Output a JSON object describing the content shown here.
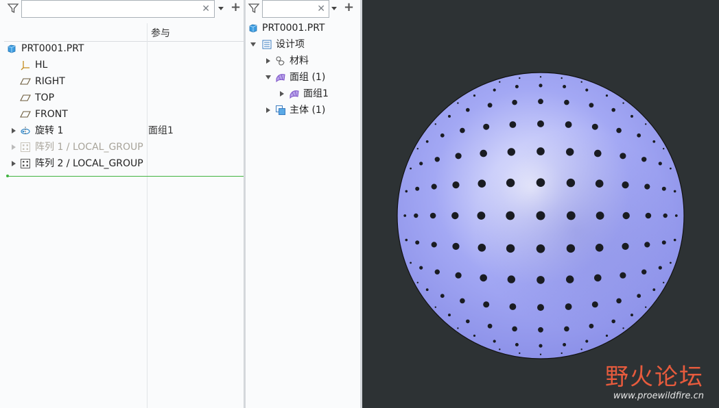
{
  "left_tree": {
    "search": {
      "value": "",
      "placeholder": ""
    },
    "column_header": "参与",
    "items": [
      {
        "label": "PRT0001.PRT",
        "icon": "part-icon",
        "ref": ""
      },
      {
        "label": "HL",
        "icon": "coordinate-system-icon",
        "ref": ""
      },
      {
        "label": "RIGHT",
        "icon": "datum-plane-icon",
        "ref": ""
      },
      {
        "label": "TOP",
        "icon": "datum-plane-icon",
        "ref": ""
      },
      {
        "label": "FRONT",
        "icon": "datum-plane-icon",
        "ref": ""
      },
      {
        "label": "旋转 1",
        "icon": "revolve-icon",
        "ref": "面组1"
      },
      {
        "label": "阵列 1 / LOCAL_GROUP",
        "icon": "pattern-icon",
        "ref": ""
      },
      {
        "label": "阵列 2 / LOCAL_GROUP",
        "icon": "pattern-icon",
        "ref": ""
      }
    ]
  },
  "mid_tree": {
    "search": {
      "value": "",
      "placeholder": ""
    },
    "items": [
      {
        "label": "PRT0001.PRT",
        "icon": "part-icon"
      },
      {
        "label": "设计项",
        "icon": "design-items-icon"
      },
      {
        "label": "材料",
        "icon": "material-icon"
      },
      {
        "label": "面组 (1)",
        "icon": "quilt-icon"
      },
      {
        "label": "面组1",
        "icon": "quilt-icon"
      },
      {
        "label": "主体 (1)",
        "icon": "body-icon"
      }
    ]
  },
  "viewport": {
    "model": "perforated-dome",
    "watermark_cn": "野火论坛",
    "watermark_url": "www.proewildfire.cn"
  },
  "colors": {
    "accent_blue": "#2e86c8",
    "viewport_bg": "#2d3234",
    "dome_light": "#f4f5ff",
    "dome_mid": "#a3a8f4",
    "dome_dark": "#7f84e0",
    "watermark_red": "#e75b3d",
    "insert_green": "#3fb33f"
  }
}
